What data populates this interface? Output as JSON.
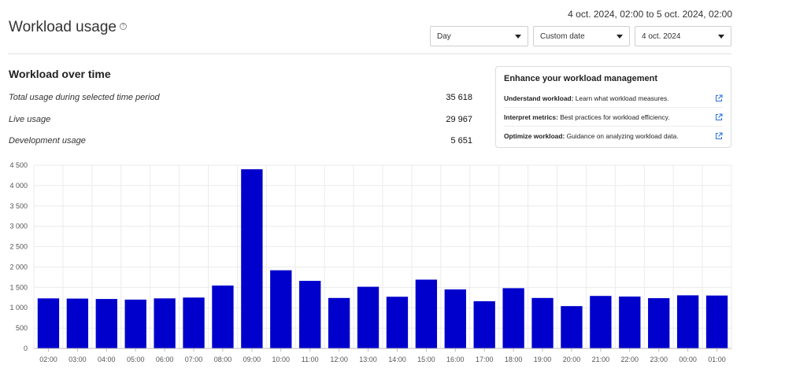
{
  "header": {
    "title": "Workload usage",
    "help_icon": "help-circle-icon",
    "date_range": "4 oct. 2024, 02:00 to 5 oct. 2024, 02:00"
  },
  "controls": {
    "granularity": "Day",
    "range": "Custom date",
    "date": "4 oct. 2024"
  },
  "section": {
    "title": "Workload over time",
    "stats": [
      {
        "label": "Total usage during selected time period",
        "value": "35 618"
      },
      {
        "label": "Live usage",
        "value": "29 967"
      },
      {
        "label": "Development usage",
        "value": "5 651"
      }
    ]
  },
  "enhance": {
    "title": "Enhance your workload management",
    "link_icon": "external-link-icon",
    "items": [
      {
        "bold": "Understand workload:",
        "text": "Learn what workload measures."
      },
      {
        "bold": "Interpret metrics:",
        "text": "Best practices for workload efficiency."
      },
      {
        "bold": "Optimize workload:",
        "text": "Guidance on analyzing workload data."
      }
    ]
  },
  "colors": {
    "bar": "#0000cc",
    "grid": "#ebebeb"
  },
  "chart_data": {
    "type": "bar",
    "title": "",
    "xlabel": "",
    "ylabel": "",
    "ylim": [
      0,
      4500
    ],
    "yticks": [
      "0",
      "500",
      "1 000",
      "1 500",
      "2 000",
      "2 500",
      "3 000",
      "3 500",
      "4 000",
      "4 500"
    ],
    "grid": true,
    "categories": [
      "02:00",
      "03:00",
      "04:00",
      "05:00",
      "06:00",
      "07:00",
      "08:00",
      "09:00",
      "10:00",
      "11:00",
      "12:00",
      "13:00",
      "14:00",
      "15:00",
      "16:00",
      "17:00",
      "18:00",
      "19:00",
      "20:00",
      "21:00",
      "22:00",
      "23:00",
      "00:00",
      "01:00"
    ],
    "values": [
      1230,
      1225,
      1215,
      1200,
      1230,
      1250,
      1545,
      4400,
      1920,
      1660,
      1240,
      1515,
      1270,
      1690,
      1450,
      1160,
      1480,
      1240,
      1040,
      1290,
      1275,
      1235,
      1305,
      1300
    ]
  }
}
